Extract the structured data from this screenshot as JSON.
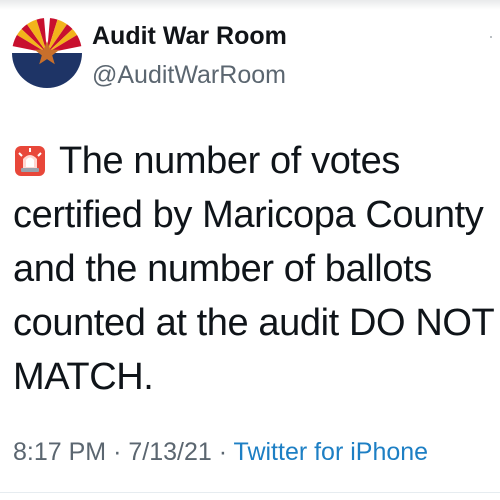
{
  "tweet": {
    "display_name": "Audit War Room",
    "handle": "@AuditWarRoom",
    "avatar_icon": "arizona-flag-avatar",
    "text": "The number of votes certified by Maricopa County and the number of ballots counted at the audit DO NOT MATCH.",
    "emoji_icon": "police-siren-icon",
    "time": "8:17 PM",
    "separator": "·",
    "date": "7/13/21",
    "source": "Twitter for iPhone"
  },
  "colors": {
    "link": "#1d7fc4",
    "secondary_text": "#5b6670",
    "avatar_navy": "#1e3466",
    "avatar_red": "#c8102e",
    "avatar_gold": "#f2b41b",
    "avatar_copper": "#c86f2b"
  }
}
